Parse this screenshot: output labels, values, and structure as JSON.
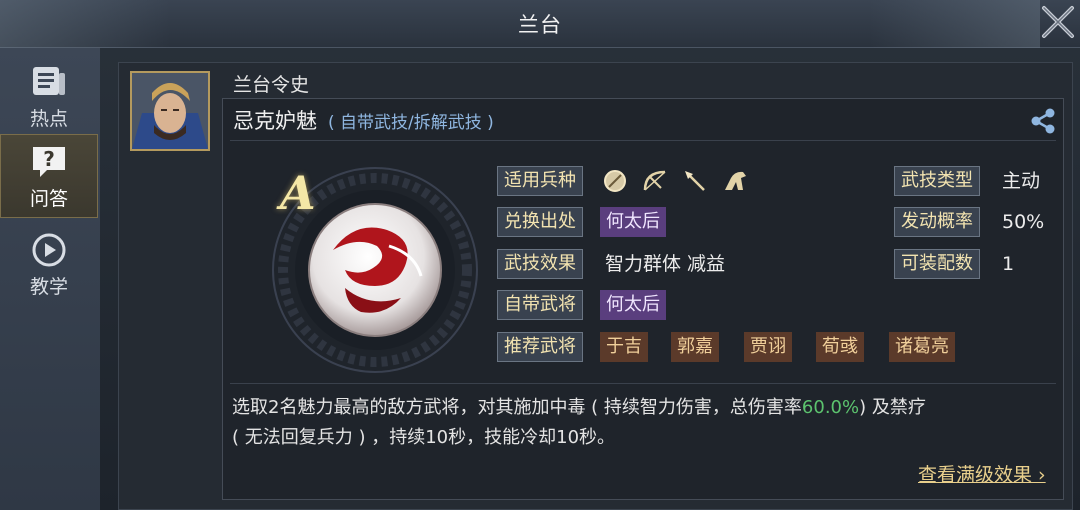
{
  "window": {
    "title": "兰台"
  },
  "sidebar": {
    "items": [
      {
        "label": "热点",
        "icon": "news-icon"
      },
      {
        "label": "问答",
        "icon": "question-icon",
        "active": true
      },
      {
        "label": "教学",
        "icon": "play-icon"
      }
    ]
  },
  "card": {
    "caption": "兰台令史",
    "skill": {
      "name": "忌克妒魅",
      "tags": "( 自带武技/拆解武技 )",
      "grade": "A",
      "rows": [
        {
          "label": "适用兵种",
          "unit_icons": [
            "shield-icon",
            "bow-icon",
            "spear-icon",
            "horse-icon"
          ]
        },
        {
          "label": "兑换出处",
          "chips": [
            "何太后"
          ],
          "chip_color": "purple"
        },
        {
          "label": "武技效果",
          "value": "智力群体 减益"
        },
        {
          "label": "自带武将",
          "chips": [
            "何太后"
          ],
          "chip_color": "purple"
        },
        {
          "label": "推荐武将",
          "chips": [
            "于吉",
            "郭嘉",
            "贾诩",
            "荀彧",
            "诸葛亮"
          ],
          "chip_color": "brown"
        }
      ],
      "right_rows": [
        {
          "label": "武技类型",
          "value": "主动"
        },
        {
          "label": "发动概率",
          "value": "50%"
        },
        {
          "label": "可装配数",
          "value": "1"
        }
      ],
      "description_part1": "选取2名魅力最高的敌方武将，对其施加中毒 ( 持续智力伤害，总伤害率",
      "description_highlight": "60.0%",
      "description_part2": ") 及禁疗",
      "description_line2": "( 无法回复兵力 ) ，持续10秒，技能冷却10秒。",
      "more_link": "查看满级效果 ›"
    }
  },
  "colors": {
    "accent_gold": "#e8cf8c",
    "highlight_green": "#5cc36e",
    "chip_purple": "#5a3e7e",
    "chip_brown": "#5b3a2a",
    "tag_blue": "#8fb6e0"
  }
}
